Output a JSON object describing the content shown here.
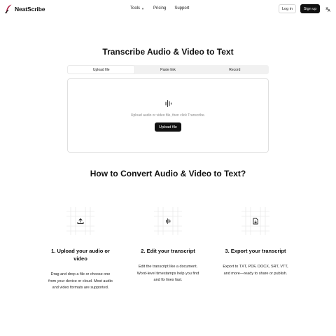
{
  "header": {
    "logo_text": "NeatScribe",
    "nav": [
      {
        "label": "Tools",
        "has_dropdown": true
      },
      {
        "label": "Pricing"
      },
      {
        "label": "Support"
      }
    ],
    "login_label": "Log in",
    "signup_label": "Sign up",
    "language_icon": "translate-icon"
  },
  "hero": {
    "title": "Transcribe Audio & Video to Text",
    "tabs": [
      {
        "label": "Upload file",
        "active": true
      },
      {
        "label": "Paste link",
        "active": false
      },
      {
        "label": "Record",
        "active": false
      }
    ],
    "upload": {
      "icon": "waveform-icon",
      "hint": "Upload audio or video file, then click Transcribe.",
      "button_label": "Upload file"
    }
  },
  "howto": {
    "title": "How to Convert Audio & Video to Text?",
    "steps": [
      {
        "icon": "upload-icon",
        "title": "1. Upload your audio or video",
        "desc": "Drag and drop a file or choose one from your device or cloud. Most audio and video formats are supported."
      },
      {
        "icon": "waveform-icon",
        "title": "2. Edit your transcript",
        "desc": "Edit the transcript like a document. Word-level timestamps help you find and fix lines fast."
      },
      {
        "icon": "export-file-icon",
        "title": "3. Export your transcript",
        "desc": "Export to TXT, PDF, DOCX, SRT, VTT, and more—ready to share or publish."
      }
    ]
  },
  "colors": {
    "primary": "#111111",
    "muted_text": "#8a8a8a",
    "border": "#e0e0e0",
    "tab_bg": "#f1f1f1",
    "logo_accent": "#b0264a"
  }
}
